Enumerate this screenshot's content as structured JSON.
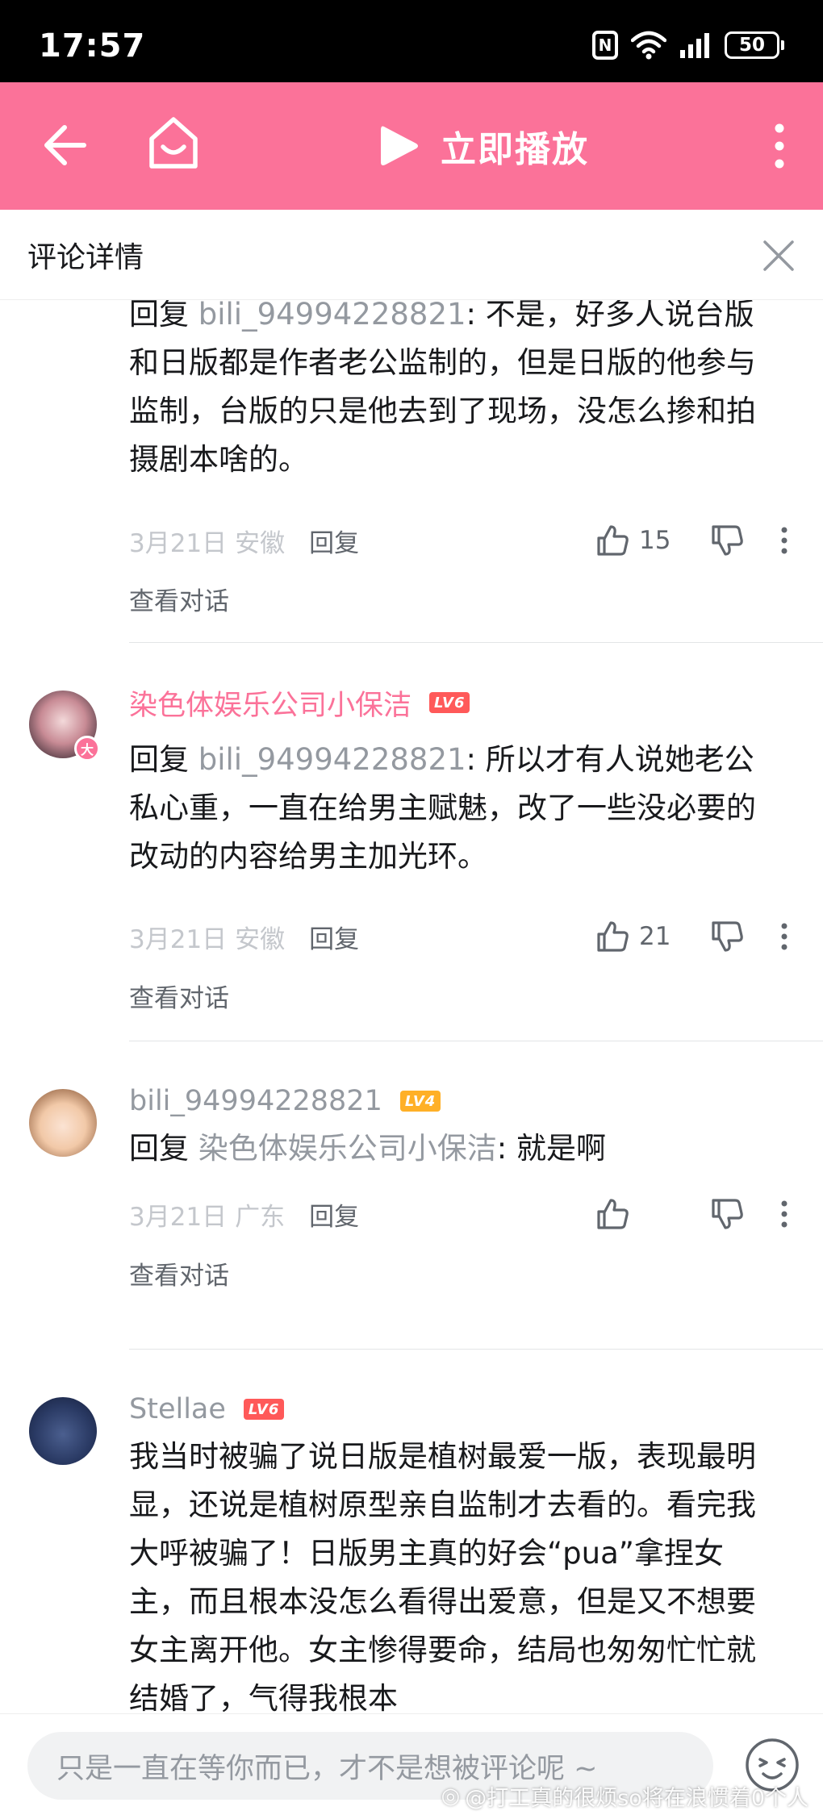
{
  "status_bar": {
    "time": "17:57",
    "battery": "50",
    "nfc": "N"
  },
  "header": {
    "play_label": "立即播放"
  },
  "detail": {
    "title": "评论详情"
  },
  "comments": [
    {
      "username": "",
      "level": "",
      "reply_prefix": "回复 ",
      "mention": "bili_94994228821",
      "text": ": 不是，好多人说台版和日版都是作者老公监制的，但是日版的他参与监制，台版的只是他去到了现场，没怎么掺和拍摄剧本啥的。",
      "date": "3月21日",
      "location": "安徽",
      "reply_label": "回复",
      "likes": "15",
      "view_conversation": "查看对话"
    },
    {
      "username": "染色体娱乐公司小保洁",
      "level": "LV6",
      "badge": "大",
      "reply_prefix": "回复 ",
      "mention": "bili_94994228821",
      "text": ": 所以才有人说她老公私心重，一直在给男主赋魅，改了一些没必要的改动的内容给男主加光环。",
      "date": "3月21日",
      "location": "安徽",
      "reply_label": "回复",
      "likes": "21",
      "view_conversation": "查看对话"
    },
    {
      "username": "bili_94994228821",
      "level": "LV4",
      "reply_prefix": "回复 ",
      "mention": "染色体娱乐公司小保洁",
      "text": ": 就是啊",
      "date": "3月21日",
      "location": "广东",
      "reply_label": "回复",
      "likes": "",
      "view_conversation": "查看对话"
    },
    {
      "username": "Stellae",
      "level": "LV6",
      "text": "我当时被骗了说日版是植树最爱一版，表现最明显，还说是植树原型亲自监制才去看的。看完我大呼被骗了！日版男主真的好会“pua”拿捏女主，而且根本没怎么看得出爱意，但是又不想要女主离开他。女主惨得要命，结局也匆匆忙忙就结婚了，气得我根本"
    }
  ],
  "input": {
    "placeholder": "只是一直在等你而已，才不是想被评论呢 ~"
  },
  "watermark": "@打工真的很烦so将在浪惯着0个人",
  "colors": {
    "brand_pink": "#fb7299",
    "lv6": "#ff5959",
    "lv4": "#ffb027",
    "gray_text": "#9499a0"
  }
}
